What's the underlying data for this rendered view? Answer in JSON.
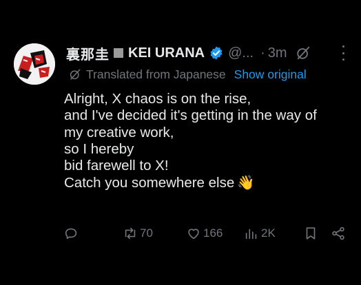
{
  "tweet": {
    "author_name_jp": "裏那圭",
    "author_name_en": "KEI URANA",
    "handle": "@...",
    "separator": "·",
    "time": "3m",
    "translation_note": "Translated from Japanese",
    "show_original_label": "Show original",
    "body_lines": [
      "Alright, X chaos is on the rise,",
      "and I've decided it's getting in the way of",
      "my creative work,",
      "so I hereby",
      "bid farewell to X!",
      "Catch you somewhere else"
    ],
    "emoji": "👋"
  },
  "actions": {
    "reply_count": "",
    "repost_count": "70",
    "like_count": "166",
    "views_count": "2K"
  },
  "colors": {
    "background": "#000000",
    "text": "#e7e9ea",
    "muted": "#71767b",
    "link": "#1d9bf0",
    "verified": "#1d9bf0"
  },
  "icons": [
    "avatar",
    "verified-badge-icon",
    "grok-icon",
    "more-icon",
    "translate-icon",
    "reply-icon",
    "repost-icon",
    "like-icon",
    "views-icon",
    "bookmark-icon",
    "share-icon"
  ]
}
